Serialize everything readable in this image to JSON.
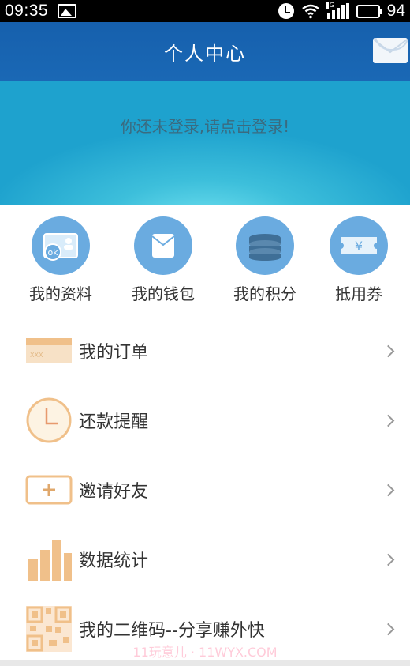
{
  "status_bar": {
    "time": "09:35",
    "battery": "94",
    "network": "4G"
  },
  "header": {
    "title": "个人中心",
    "mail_icon": "envelope-icon"
  },
  "banner": {
    "prompt": "你还未登录,请点击登录!"
  },
  "quick_actions": [
    {
      "label": "我的资料",
      "icon": "profile-card-icon"
    },
    {
      "label": "我的钱包",
      "icon": "wallet-icon"
    },
    {
      "label": "我的积分",
      "icon": "coin-stack-icon"
    },
    {
      "label": "抵用券",
      "icon": "coupon-icon"
    }
  ],
  "menu": [
    {
      "label": "我的订单",
      "icon": "card-icon"
    },
    {
      "label": "还款提醒",
      "icon": "clock-icon"
    },
    {
      "label": "邀请好友",
      "icon": "plus-box-icon"
    },
    {
      "label": "数据统计",
      "icon": "bar-chart-icon"
    },
    {
      "label": "我的二维码--分享赚外快",
      "icon": "qr-code-icon"
    }
  ],
  "watermark": "11玩意儿 · 11WYX.COM",
  "colors": {
    "header": "#1660ad",
    "banner": "#3dbfdb",
    "quick_circle": "#6aabe0",
    "menu_icon": "#f0c08a"
  }
}
